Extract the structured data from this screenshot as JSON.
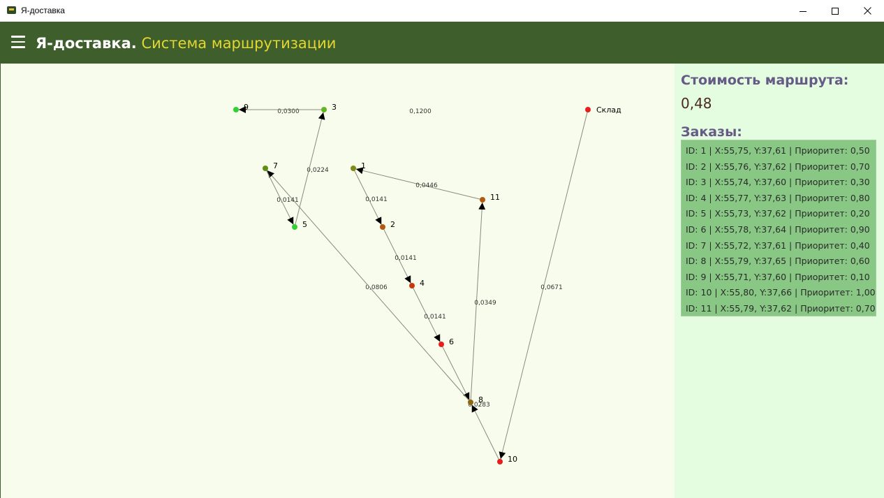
{
  "window": {
    "title": "Я-доставка",
    "controls": [
      "minimize-icon",
      "maximize-icon",
      "close-icon"
    ]
  },
  "appbar": {
    "menu_icon": "hamburger-menu-icon",
    "brand": "Я-доставка.",
    "subtitle": "Система маршрутизации"
  },
  "sidebar": {
    "cost_heading": "Стоимость маршрута:",
    "cost_value": "0,48",
    "orders_heading": "Заказы:",
    "orders": [
      "ID: 1 | X:55,75, Y:37,61 | Приоритет: 0,50",
      "ID: 2 | X:55,76, Y:37,62 | Приоритет: 0,70",
      "ID: 3 | X:55,74, Y:37,60 | Приоритет: 0,30",
      "ID: 4 | X:55,77, Y:37,63 | Приоритет: 0,80",
      "ID: 5 | X:55,73, Y:37,62 | Приоритет: 0,20",
      "ID: 6 | X:55,78, Y:37,64 | Приоритет: 0,90",
      "ID: 7 | X:55,72, Y:37,61 | Приоритет: 0,40",
      "ID: 8 | X:55,79, Y:37,65 | Приоритет: 0,60",
      "ID: 9 | X:55,71, Y:37,60 | Приоритет: 0,10",
      "ID: 10 | X:55,80, Y:37,66 | Приоритет: 1,00",
      "ID: 11 | X:55,79, Y:37,62 | Приоритет: 0,70"
    ]
  },
  "graph": {
    "nodes": [
      {
        "id": "Склад",
        "label": "Склад",
        "color": "#e81e1e"
      },
      {
        "id": "10",
        "label": "10",
        "color": "#e81e1e"
      },
      {
        "id": "8",
        "label": "8",
        "color": "#8f6612"
      },
      {
        "id": "11",
        "label": "11",
        "color": "#b25a12"
      },
      {
        "id": "1",
        "label": "1",
        "color": "#808a14"
      },
      {
        "id": "2",
        "label": "2",
        "color": "#b25a12"
      },
      {
        "id": "4",
        "label": "4",
        "color": "#c8380e"
      },
      {
        "id": "6",
        "label": "6",
        "color": "#e81e1e"
      },
      {
        "id": "7",
        "label": "7",
        "color": "#5f8e14"
      },
      {
        "id": "5",
        "label": "5",
        "color": "#30d130"
      },
      {
        "id": "3",
        "label": "3",
        "color": "#5fb81e"
      },
      {
        "id": "9",
        "label": "9",
        "color": "#30d130"
      }
    ],
    "edges": [
      {
        "from": "Склад",
        "to": "10",
        "label": "0,0671"
      },
      {
        "from": "10",
        "to": "8",
        "label": "0,0283"
      },
      {
        "from": "8",
        "to": "11",
        "label": "0,0349"
      },
      {
        "from": "11",
        "to": "1",
        "label": "0,0446"
      },
      {
        "from": "1",
        "to": "2",
        "label": "0,0141"
      },
      {
        "from": "2",
        "to": "4",
        "label": "0,0141"
      },
      {
        "from": "4",
        "to": "6",
        "label": "0,0141"
      },
      {
        "from": "6",
        "to": "8",
        "label": "0,0806"
      },
      {
        "from": "8",
        "to": "7",
        "label": "0,0141"
      },
      {
        "from": "7",
        "to": "5",
        "label": "0,0224"
      },
      {
        "from": "5",
        "to": "3",
        "label": "0,0300"
      },
      {
        "from": "3",
        "to": "9",
        "label": "0,1200"
      }
    ]
  }
}
